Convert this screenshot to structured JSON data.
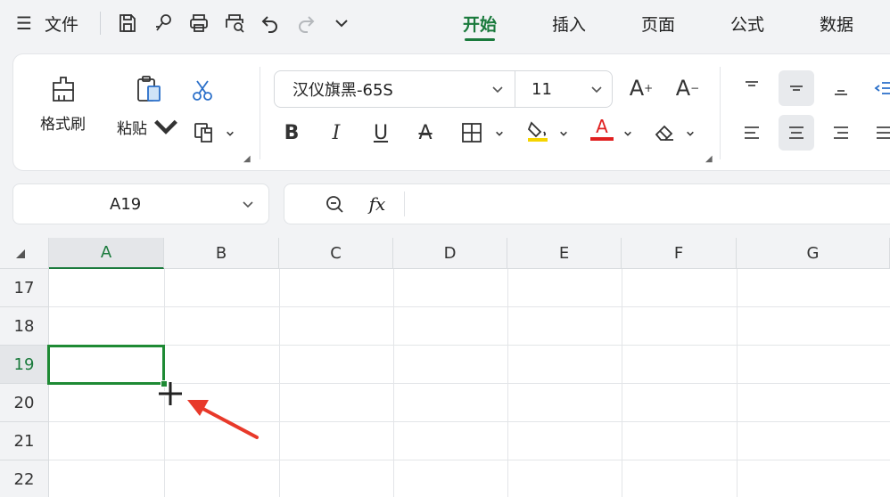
{
  "menubar": {
    "hamburger": "☰",
    "file_label": "文件",
    "tabs": [
      "开始",
      "插入",
      "页面",
      "公式",
      "数据"
    ],
    "active_tab": "开始"
  },
  "ribbon": {
    "format_painter_label": "格式刷",
    "paste_label": "粘贴",
    "font_name": "汉仪旗黑-65S",
    "font_size": "11",
    "increase_font": "A",
    "decrease_font": "A",
    "bold": "B",
    "italic": "I",
    "underline": "U",
    "strikethrough": "A",
    "font_color_letter": "A",
    "highlight_color": "#f5d400",
    "font_color": "#e02020"
  },
  "namebox": {
    "value": "A19"
  },
  "formulabar": {
    "fx_label": "fx",
    "value": ""
  },
  "grid": {
    "columns": [
      "A",
      "B",
      "C",
      "D",
      "E",
      "F",
      "G"
    ],
    "rows": [
      "17",
      "18",
      "19",
      "20",
      "21",
      "22"
    ],
    "selected_cell": "A19",
    "accent_color": "#1e8a34"
  }
}
